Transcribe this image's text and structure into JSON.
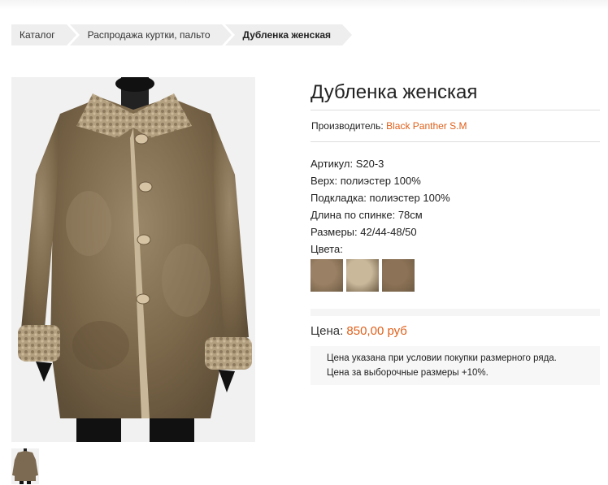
{
  "breadcrumb": {
    "items": [
      "Каталог",
      "Распродажа куртки, пальто",
      "Дубленка женская"
    ]
  },
  "product": {
    "title": "Дубленка женская",
    "maker_label": "Производитель:",
    "maker_name": "Black Panther S.M",
    "specs": [
      "Артикул: S20-3",
      "Верх: полиэстер 100%",
      "Подкладка: полиэстер 100%",
      "Длина по спинке: 78см",
      "Размеры: 42/44-48/50",
      "Цвета:"
    ],
    "swatch_colors": [
      "#9a8064",
      "#c9b89a",
      "#8c7256"
    ],
    "price_label": "Цена:",
    "price_value": "850,00 руб",
    "notes": [
      "Цена указана при условии покупки размерного ряда.",
      "Цена за выборочные размеры +10%."
    ]
  },
  "colors": {
    "accent": "#e0601a",
    "coat": "#7d6a52",
    "fur": "#a89478"
  }
}
